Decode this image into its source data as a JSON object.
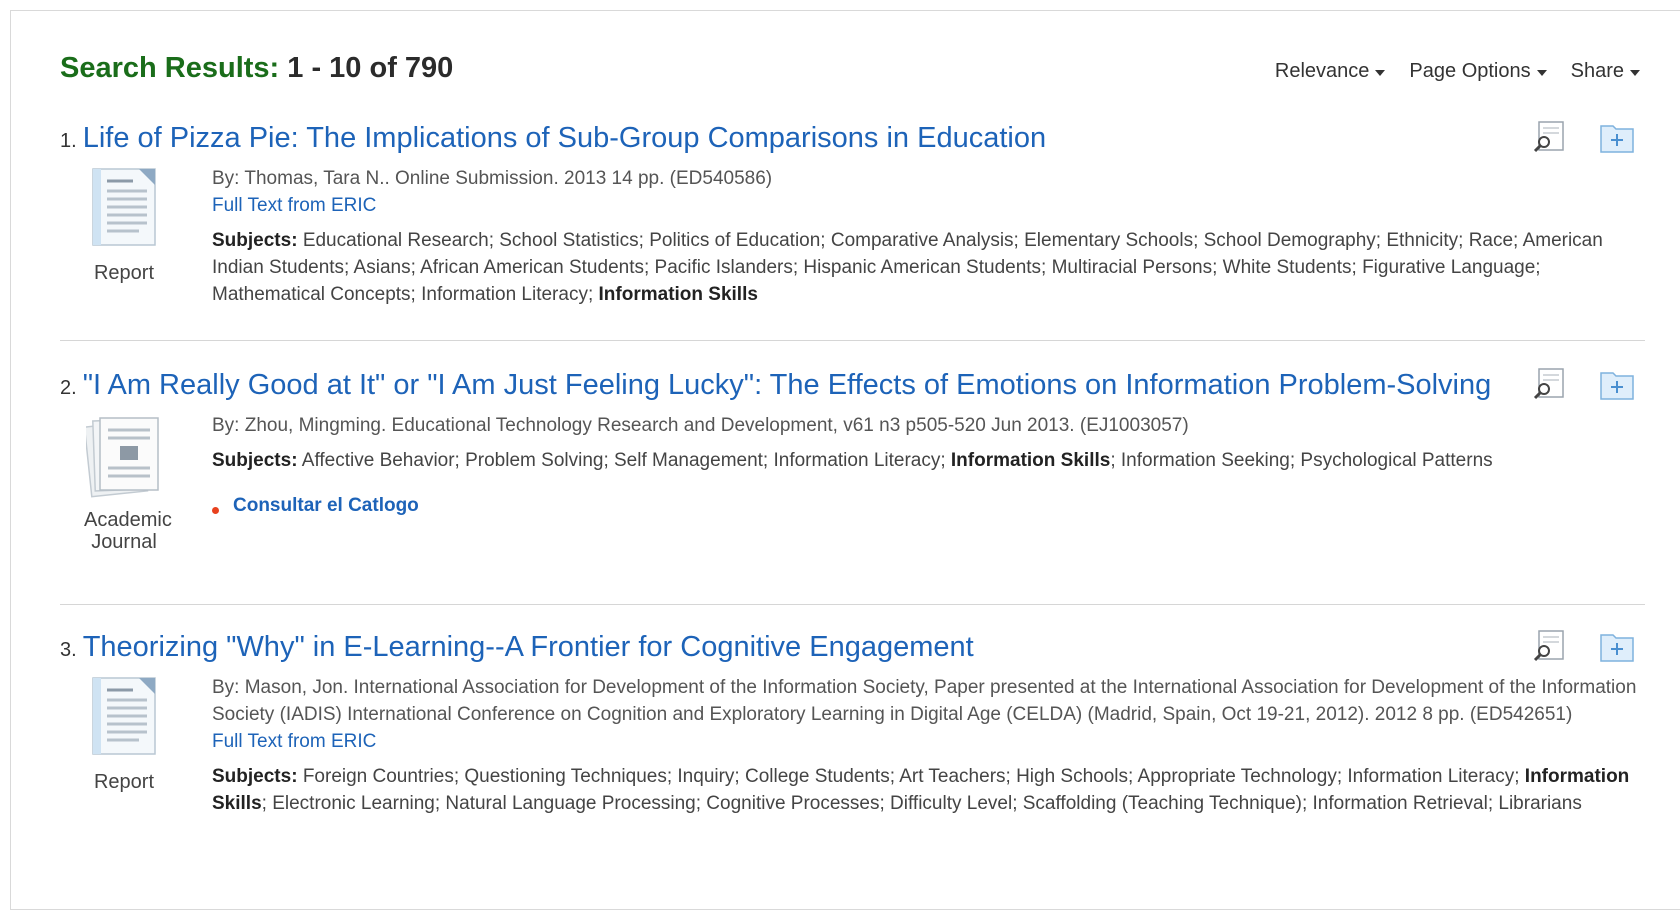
{
  "header": {
    "label": "Search Results:",
    "range": "1 - 10 of 790",
    "options": [
      "Relevance",
      "Page Options",
      "Share"
    ]
  },
  "results": [
    {
      "number": "1.",
      "title": "Life of Pizza Pie: The Implications of Sub-Group Comparisons in Education",
      "type": "Report",
      "meta": "By: Thomas, Tara N.. Online Submission. 2013 14 pp. (ED540586)",
      "full_text": "Full Text from ERIC",
      "subjects_label": "Subjects:",
      "subjects_before": "Educational Research; School Statistics; Politics of Education; Comparative Analysis; Elementary Schools; School Demography; Ethnicity; Race; American Indian Students; Asians; African American Students; Pacific Islanders; Hispanic American Students; Multiracial Persons; White Students; Figurative Language; Mathematical Concepts; Information Literacy; ",
      "subjects_bold": "Information Skills",
      "subjects_after": ""
    },
    {
      "number": "2.",
      "title": "\"I Am Really Good at It\" or \"I Am Just Feeling Lucky\": The Effects of Emotions on Information Problem-Solving",
      "type": "Academic Journal",
      "meta": "By: Zhou, Mingming. Educational Technology Research and Development, v61 n3 p505-520 Jun 2013. (EJ1003057)",
      "subjects_label": "Subjects:",
      "subjects_before": "Affective Behavior; Problem Solving; Self Management; Information Literacy; ",
      "subjects_bold": "Information Skills",
      "subjects_after": "; Information Seeking; Psychological Patterns",
      "catalog": "Consultar el Catlogo"
    },
    {
      "number": "3.",
      "title": "Theorizing \"Why\" in E-Learning--A Frontier for Cognitive Engagement",
      "type": "Report",
      "meta": "By: Mason, Jon. International Association for Development of the Information Society, Paper presented at the International Association for Development of the Information Society (IADIS) International Conference on Cognition and Exploratory Learning in Digital Age (CELDA) (Madrid, Spain, Oct 19-21, 2012). 2012 8 pp. (ED542651)",
      "full_text": "Full Text from ERIC",
      "subjects_label": "Subjects:",
      "subjects_before": "Foreign Countries; Questioning Techniques; Inquiry; College Students; Art Teachers; High Schools; Appropriate Technology; Information Literacy; ",
      "subjects_bold": "Information Skills",
      "subjects_after": "; Electronic Learning; Natural Language Processing; Cognitive Processes; Difficulty Level; Scaffolding (Teaching Technique); Information Retrieval; Librarians"
    }
  ],
  "icons": {
    "preview": "magnifier-page-icon",
    "add": "add-to-folder-icon",
    "report": "report-document-icon",
    "journal": "journal-stack-icon"
  }
}
